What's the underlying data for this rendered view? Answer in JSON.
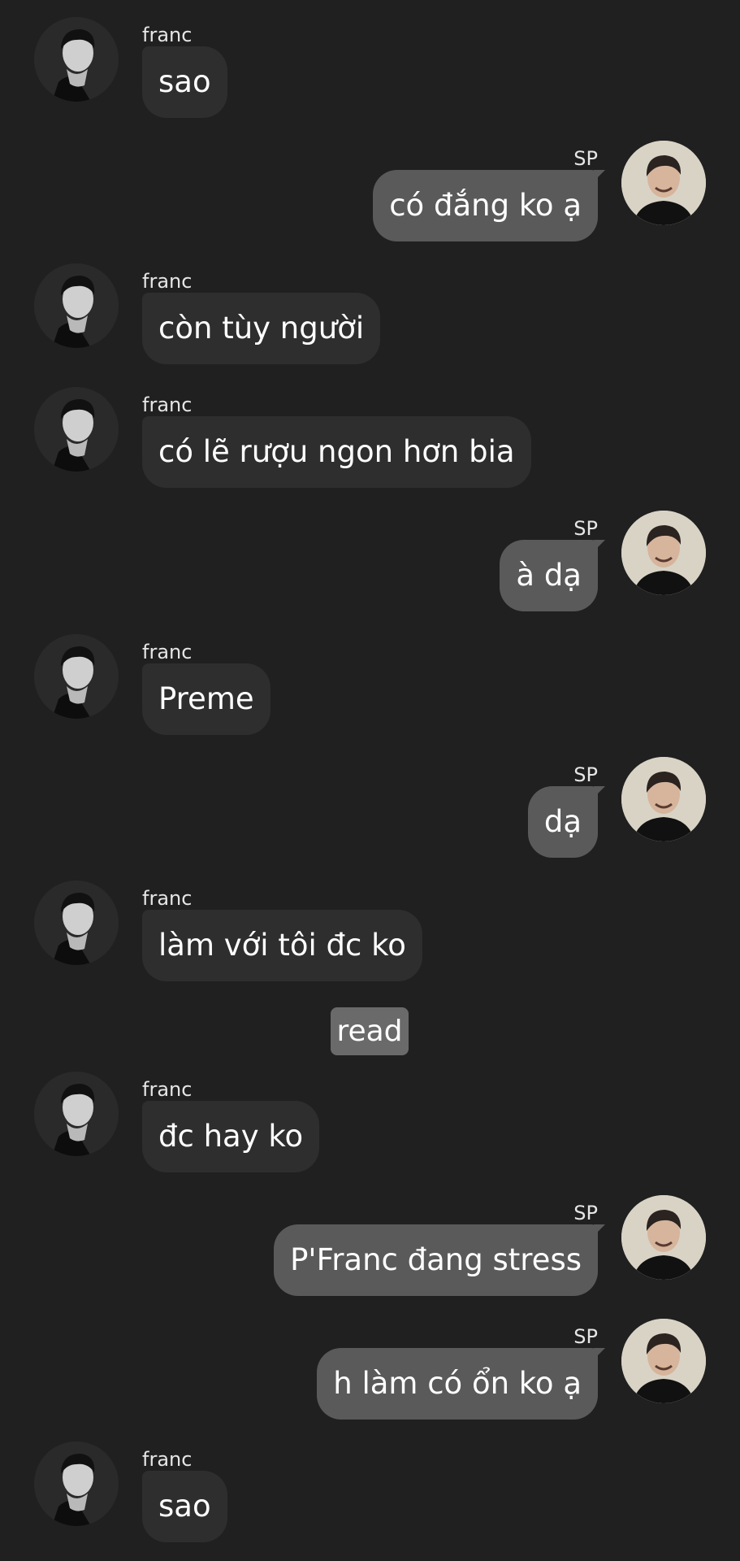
{
  "messages": [
    {
      "id": "m1",
      "direction": "incoming",
      "sender": "franc",
      "text": "sao",
      "avatar": "franc-avatar"
    },
    {
      "id": "m2",
      "direction": "outgoing",
      "sender": "SP",
      "text": "có đắng ko ạ",
      "avatar": "sp-avatar"
    },
    {
      "id": "m3",
      "direction": "incoming",
      "sender": "franc",
      "text": "còn tùy người",
      "avatar": "franc-avatar"
    },
    {
      "id": "m4",
      "direction": "incoming",
      "sender": "franc",
      "text": "có lẽ rượu ngon hơn bia",
      "avatar": "franc-avatar"
    },
    {
      "id": "m5",
      "direction": "outgoing",
      "sender": "SP",
      "text": "à dạ",
      "avatar": "sp-avatar"
    },
    {
      "id": "m6",
      "direction": "incoming",
      "sender": "franc",
      "text": "Preme",
      "avatar": "franc-avatar"
    },
    {
      "id": "m7",
      "direction": "outgoing",
      "sender": "SP",
      "text": "dạ",
      "avatar": "sp-avatar"
    },
    {
      "id": "m8",
      "direction": "incoming",
      "sender": "franc",
      "text": "làm với tôi đc ko",
      "avatar": "franc-avatar"
    },
    {
      "id": "m9",
      "direction": "incoming",
      "sender": "franc",
      "text": "đc hay ko",
      "avatar": "franc-avatar"
    },
    {
      "id": "m10",
      "direction": "outgoing",
      "sender": "SP",
      "text": "P'Franc đang stress",
      "avatar": "sp-avatar"
    },
    {
      "id": "m11",
      "direction": "outgoing",
      "sender": "SP",
      "text": "h làm có ổn ko ạ",
      "avatar": "sp-avatar"
    },
    {
      "id": "m12",
      "direction": "incoming",
      "sender": "franc",
      "text": "sao",
      "avatar": "franc-avatar"
    }
  ],
  "read_badge": "read",
  "colors": {
    "background": "#202020",
    "incoming_bubble": "#2e2e2e",
    "outgoing_bubble": "#5a5a5a",
    "read_badge": "#6a6a6a",
    "text": "#ffffff"
  }
}
